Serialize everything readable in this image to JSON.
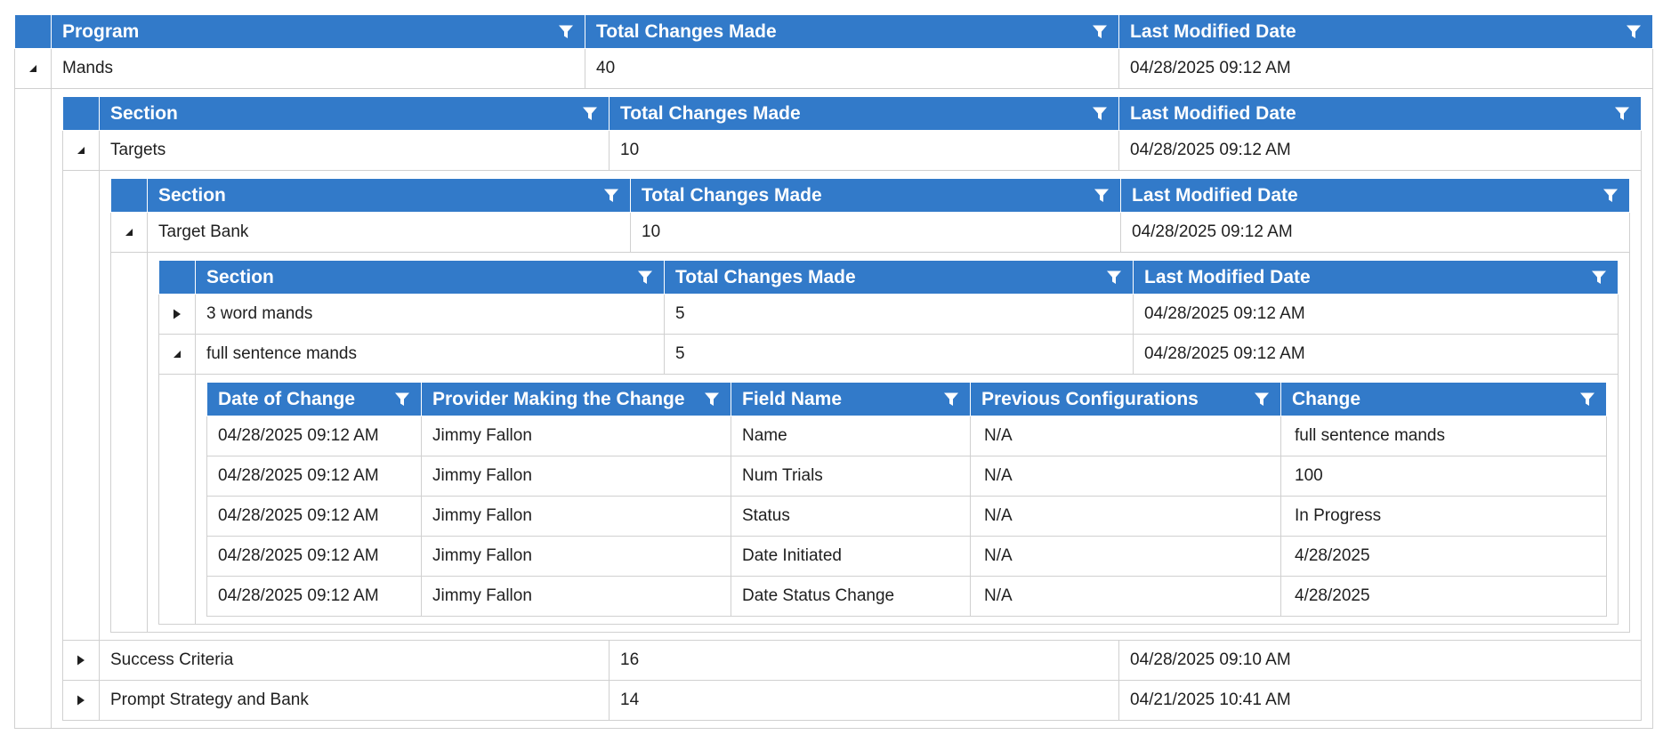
{
  "colors": {
    "header_bg": "#327ac9",
    "header_text": "#ffffff",
    "border": "#d0d0d0"
  },
  "icons": {
    "filter": "filter-icon",
    "expanded": "caret-expanded-icon",
    "collapsed": "caret-collapsed-icon"
  },
  "program_grid": {
    "headers": [
      "Program",
      "Total Changes Made",
      "Last Modified Date"
    ],
    "rows": [
      {
        "name": "Mands",
        "total": "40",
        "date": "04/28/2025 09:12 AM",
        "expanded": true
      }
    ]
  },
  "section_grid": {
    "headers": [
      "Section",
      "Total Changes Made",
      "Last Modified Date"
    ],
    "rows": [
      {
        "name": "Targets",
        "total": "10",
        "date": "04/28/2025 09:12 AM",
        "expanded": true
      },
      {
        "name": "Success Criteria",
        "total": "16",
        "date": "04/28/2025 09:10 AM",
        "expanded": false
      },
      {
        "name": "Prompt Strategy and Bank",
        "total": "14",
        "date": "04/21/2025 10:41 AM",
        "expanded": false
      }
    ]
  },
  "subsection_grid": {
    "headers": [
      "Section",
      "Total Changes Made",
      "Last Modified Date"
    ],
    "rows": [
      {
        "name": "Target Bank",
        "total": "10",
        "date": "04/28/2025 09:12 AM",
        "expanded": true
      }
    ]
  },
  "target_grid": {
    "headers": [
      "Section",
      "Total Changes Made",
      "Last Modified Date"
    ],
    "rows": [
      {
        "name": "3 word mands",
        "total": "5",
        "date": "04/28/2025 09:12 AM",
        "expanded": false
      },
      {
        "name": "full sentence mands",
        "total": "5",
        "date": "04/28/2025 09:12 AM",
        "expanded": true
      }
    ]
  },
  "change_grid": {
    "headers": [
      "Date of Change",
      "Provider Making the Change",
      "Field Name",
      "Previous Configurations",
      "Change"
    ],
    "rows": [
      [
        "04/28/2025 09:12 AM",
        "Jimmy Fallon",
        "Name",
        "N/A",
        "full sentence mands"
      ],
      [
        "04/28/2025 09:12 AM",
        "Jimmy Fallon",
        "Num Trials",
        "N/A",
        "100"
      ],
      [
        "04/28/2025 09:12 AM",
        "Jimmy Fallon",
        "Status",
        "N/A",
        "In Progress"
      ],
      [
        "04/28/2025 09:12 AM",
        "Jimmy Fallon",
        "Date Initiated",
        "N/A",
        "4/28/2025"
      ],
      [
        "04/28/2025 09:12 AM",
        "Jimmy Fallon",
        "Date Status Change",
        "N/A",
        "4/28/2025"
      ]
    ]
  }
}
